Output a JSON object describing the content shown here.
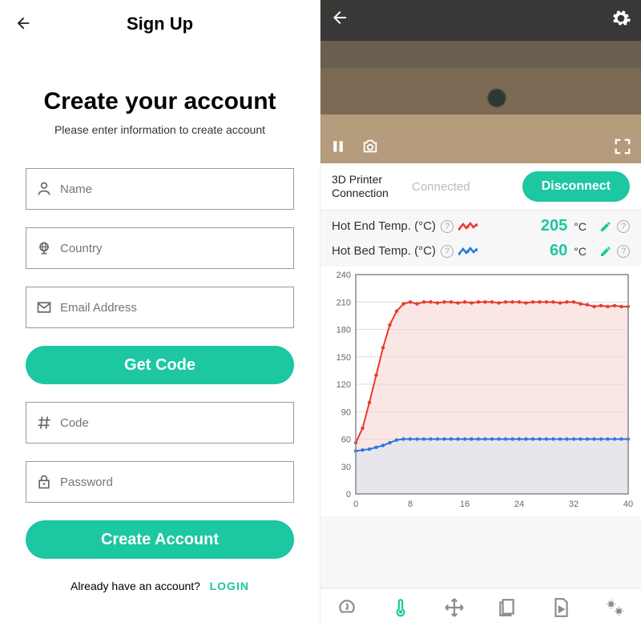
{
  "left": {
    "header_title": "Sign Up",
    "h1": "Create your account",
    "subtitle": "Please enter information to create account",
    "fields": {
      "name_ph": "Name",
      "country_ph": "Country",
      "email_ph": "Email Address",
      "code_ph": "Code",
      "password_ph": "Password"
    },
    "get_code_btn": "Get Code",
    "create_btn": "Create Account",
    "login_prompt": "Already have an account?",
    "login_link": "LOGIN"
  },
  "right": {
    "connection_label": "3D Printer Connection",
    "connection_state": "Connected",
    "disconnect_btn": "Disconnect",
    "hotend_label": "Hot End Temp. (°C)",
    "hotbed_label": "Hot Bed Temp. (°C)",
    "hotend_value": "205",
    "hotbed_value": "60",
    "temp_unit": "°C"
  },
  "chart_data": {
    "type": "line",
    "xlabel": "",
    "ylabel": "",
    "x": [
      0,
      1,
      2,
      3,
      4,
      5,
      6,
      7,
      8,
      9,
      10,
      11,
      12,
      13,
      14,
      15,
      16,
      17,
      18,
      19,
      20,
      21,
      22,
      23,
      24,
      25,
      26,
      27,
      28,
      29,
      30,
      31,
      32,
      33,
      34,
      35,
      36,
      37,
      38,
      39,
      40
    ],
    "x_ticks": [
      0,
      8,
      16,
      24,
      32,
      40
    ],
    "y_ticks": [
      0,
      30,
      60,
      90,
      120,
      150,
      180,
      210,
      240
    ],
    "xlim": [
      0,
      40
    ],
    "ylim": [
      0,
      240
    ],
    "series": [
      {
        "name": "Hot End Temp. (°C)",
        "color": "#e83a2f",
        "fill": "#f7d6d3",
        "values": [
          56,
          72,
          100,
          130,
          160,
          185,
          200,
          208,
          210,
          208,
          210,
          210,
          209,
          210,
          210,
          209,
          210,
          209,
          210,
          210,
          210,
          209,
          210,
          210,
          210,
          209,
          210,
          210,
          210,
          210,
          209,
          210,
          210,
          208,
          207,
          205,
          206,
          205,
          206,
          205,
          205
        ]
      },
      {
        "name": "Hot Bed Temp. (°C)",
        "color": "#2979d8",
        "fill": "#dde4f2",
        "values": [
          47,
          48,
          49,
          51,
          53,
          56,
          59,
          60,
          60,
          60,
          60,
          60,
          60,
          60,
          60,
          60,
          60,
          60,
          60,
          60,
          60,
          60,
          60,
          60,
          60,
          60,
          60,
          60,
          60,
          60,
          60,
          60,
          60,
          60,
          60,
          60,
          60,
          60,
          60,
          60,
          60
        ]
      }
    ]
  }
}
